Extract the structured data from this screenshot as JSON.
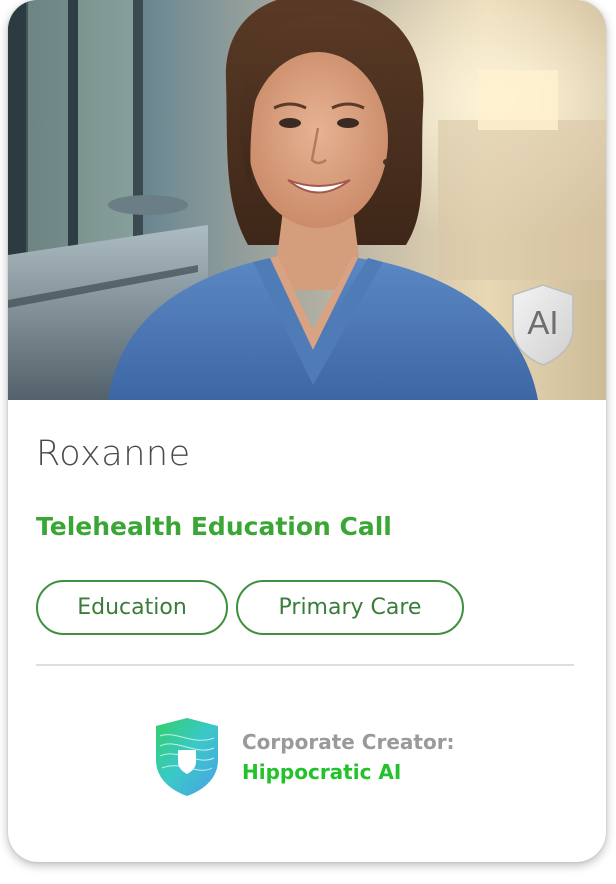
{
  "persona": {
    "name": "Roxanne",
    "title": "Telehealth Education Call",
    "badge": "AI",
    "tags": [
      "Education",
      "Primary Care"
    ]
  },
  "creator": {
    "label": "Corporate Creator:",
    "name": "Hippocratic AI",
    "logo_icon": "shield-logo-icon"
  },
  "colors": {
    "accent_green": "#3aa635",
    "creator_green": "#22c32a",
    "tag_border": "#3f8f3f",
    "scrubs_blue": "#4a78b8"
  }
}
